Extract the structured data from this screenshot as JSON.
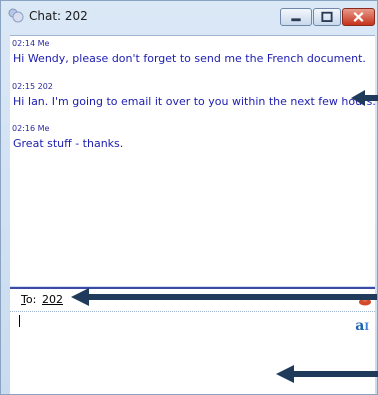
{
  "window": {
    "title": "Chat: 202"
  },
  "controls": [
    "minimize",
    "maximize",
    "close"
  ],
  "messages": [
    {
      "time": "02:14",
      "sender": "Me",
      "text": "Hi Wendy, please don't forget to send me the French document."
    },
    {
      "time": "02:15",
      "sender": "202",
      "text": "Hi Ian. I'm going to email it over to you within the next few hours."
    },
    {
      "time": "02:16",
      "sender": "Me",
      "text": "Great stuff - thanks."
    }
  ],
  "recipient": {
    "label": "To:",
    "accelerator": "T",
    "rest": "o:",
    "value": "202"
  },
  "compose": {
    "value": ""
  },
  "colors": {
    "accent": "#1c1cb0",
    "arrow": "#1f3a5a"
  }
}
